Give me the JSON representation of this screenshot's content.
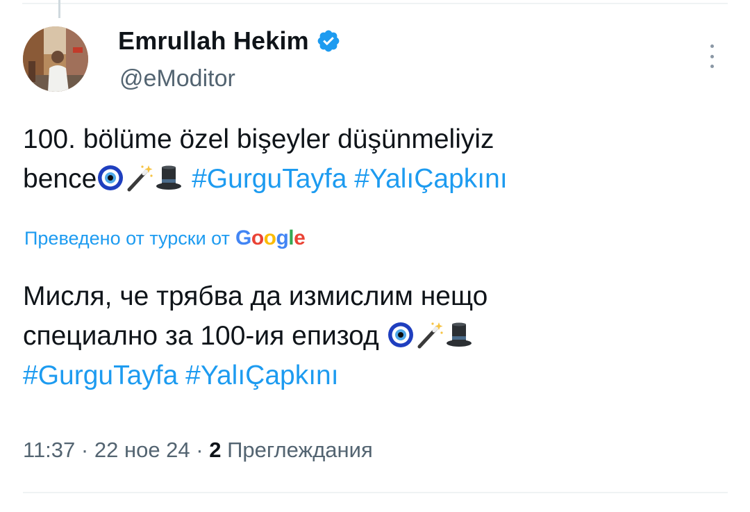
{
  "author": {
    "name": "Emrullah Hekim",
    "handle": "@eModitor",
    "verified": true
  },
  "tweet": {
    "line1": "100. bölüme özel bişeyler düşünmeliyiz",
    "line2_text": "bence",
    "emojis": [
      "nazar-amulet-icon",
      "magic-wand-icon",
      "top-hat-icon"
    ],
    "hashtags": [
      "#GurguTayfa",
      "#YalıÇapkını"
    ]
  },
  "translation": {
    "label": "Преведено от турски от",
    "provider": "Google",
    "line1": "Мисля, че трябва да измислим нещо",
    "line2_text": "специално за 100-ия епизод",
    "hashtags": [
      "#GurguTayfa",
      "#YalıÇapkını"
    ]
  },
  "meta": {
    "time": "11:37",
    "date": "22 ное 24",
    "views_count": "2",
    "views_label": "Преглеждания",
    "separator": "·"
  },
  "colors": {
    "accent": "#1d9bf0",
    "secondary_text": "#536471",
    "primary_text": "#0f1419"
  }
}
